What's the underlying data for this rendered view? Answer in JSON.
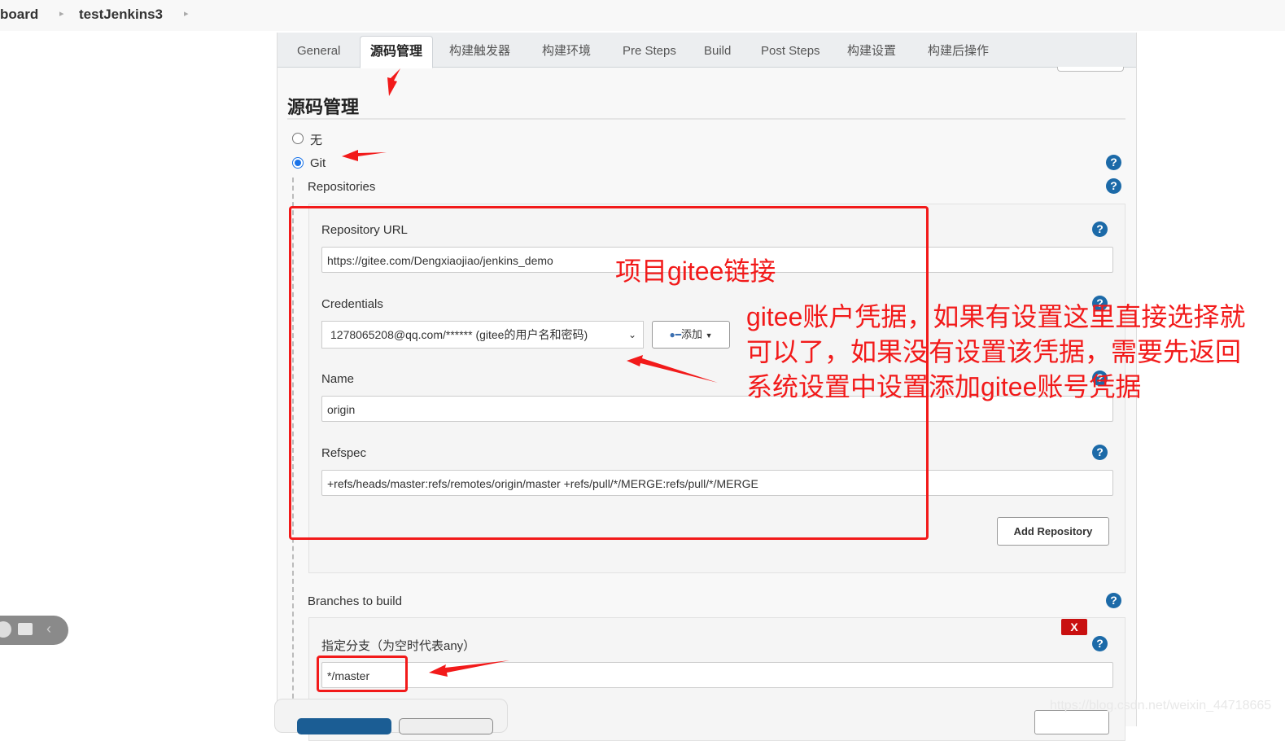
{
  "breadcrumb": {
    "items": [
      "board",
      "testJenkins3"
    ]
  },
  "tabs": [
    {
      "label": "General",
      "active": false
    },
    {
      "label": "源码管理",
      "active": true
    },
    {
      "label": "构建触发器",
      "active": false
    },
    {
      "label": "构建环境",
      "active": false
    },
    {
      "label": "Pre Steps",
      "active": false
    },
    {
      "label": "Build",
      "active": false
    },
    {
      "label": "Post Steps",
      "active": false
    },
    {
      "label": "构建设置",
      "active": false
    },
    {
      "label": "构建后操作",
      "active": false
    }
  ],
  "section": {
    "title": "源码管理",
    "scm_options": [
      {
        "label": "无",
        "checked": false
      },
      {
        "label": "Git",
        "checked": true
      }
    ],
    "repositories_label": "Repositories",
    "repository_url_label": "Repository URL",
    "repository_url_value": "https://gitee.com/Dengxiaojiao/jenkins_demo",
    "credentials_label": "Credentials",
    "credentials_value": "1278065208@qq.com/****** (gitee的用户名和密码)",
    "add_credentials_label": "添加",
    "name_label": "Name",
    "name_value": "origin",
    "refspec_label": "Refspec",
    "refspec_value": "+refs/heads/master:refs/remotes/origin/master +refs/pull/*/MERGE:refs/pull/*/MERGE",
    "add_repository_label": "Add Repository",
    "branches_label": "Branches to build",
    "branch_specifier_label": "指定分支（为空时代表any）",
    "branch_specifier_value": "*/master",
    "delete_branch_label": "X"
  },
  "annotations": {
    "repo_link": "项目gitee链接",
    "credentials_note": [
      "gitee账户凭据，如果有设置这里直接选择就",
      "可以了，如果没有设置该凭据，需要先返回",
      "系统设置中设置添加gitee账号凭据"
    ]
  },
  "watermark": "https://blog.csdn.net/weixin_44718665",
  "colors": {
    "annotation_red": "#f21a1a",
    "help_blue": "#1c6aa8",
    "delete_red": "#c91010",
    "radio_blue": "#1a73e8"
  }
}
